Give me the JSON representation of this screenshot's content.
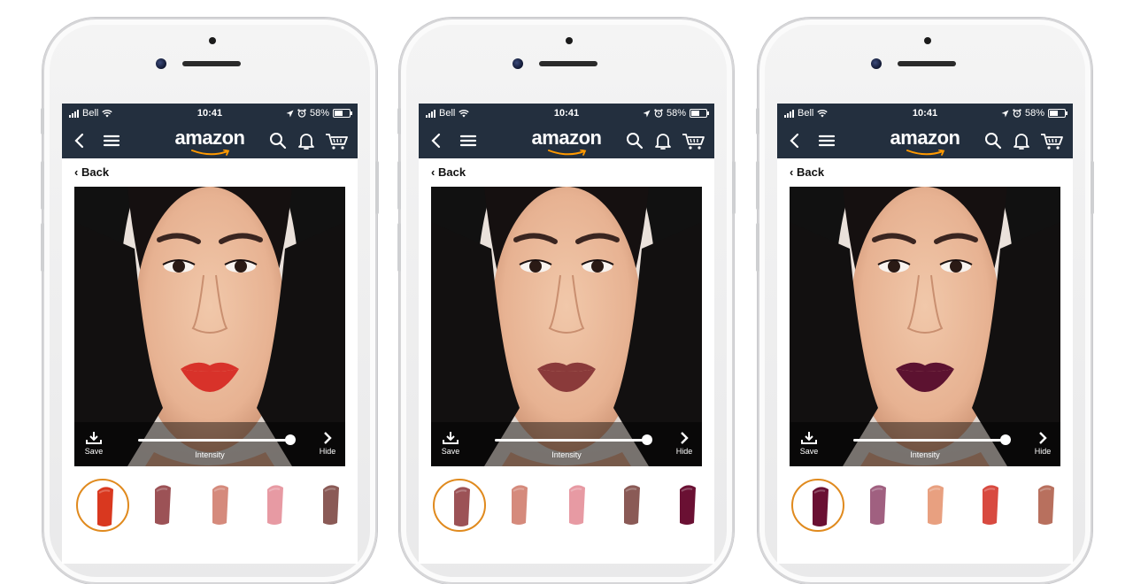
{
  "status_bar": {
    "carrier": "Bell",
    "time": "10:41",
    "battery": "58%"
  },
  "nav": {
    "logo": "amazon"
  },
  "back_label": "Back",
  "controls": {
    "save_label": "Save",
    "intensity_label": "Intensity",
    "hide_label": "Hide",
    "intensity_level": 1.0
  },
  "phones": [
    {
      "lip_color": "#d8322a",
      "selected_index": 0,
      "swatches": [
        {
          "color": "#d9381f"
        },
        {
          "color": "#9c5256"
        },
        {
          "color": "#d58a7c"
        },
        {
          "color": "#e79aa3"
        },
        {
          "color": "#8a5a56"
        }
      ]
    },
    {
      "lip_color": "#8a3a3a",
      "selected_index": 0,
      "swatches": [
        {
          "color": "#9c5256"
        },
        {
          "color": "#d58a7c"
        },
        {
          "color": "#e79aa3"
        },
        {
          "color": "#8a5a56"
        },
        {
          "color": "#6a1033"
        }
      ]
    },
    {
      "lip_color": "#5c1230",
      "selected_index": 0,
      "swatches": [
        {
          "color": "#6a1033"
        },
        {
          "color": "#a06080"
        },
        {
          "color": "#e8a080"
        },
        {
          "color": "#d84a40"
        },
        {
          "color": "#b8705e"
        }
      ]
    }
  ]
}
